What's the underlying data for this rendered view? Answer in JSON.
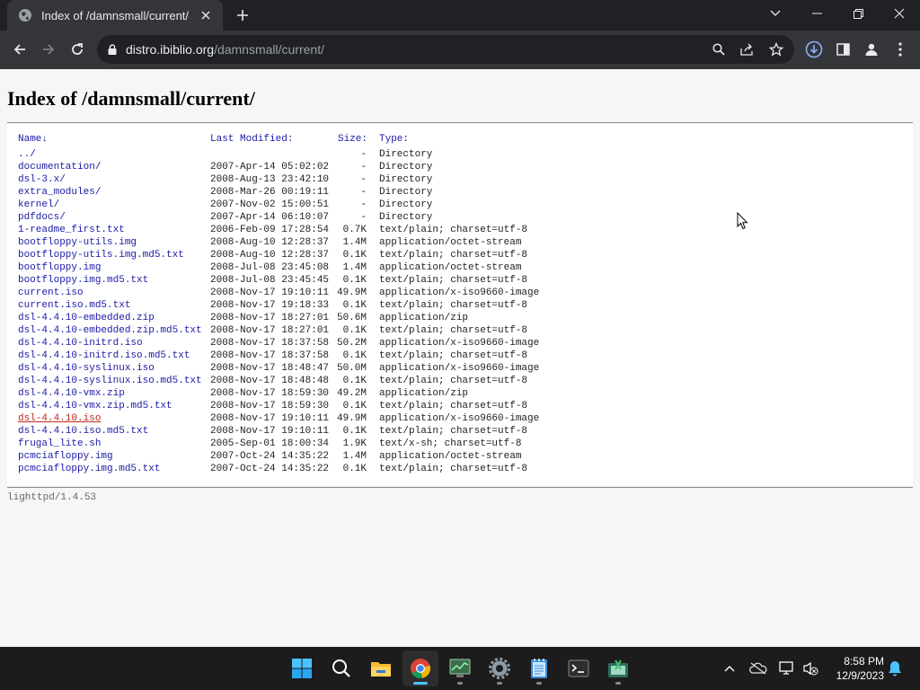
{
  "browser": {
    "tab_title": "Index of /damnsmall/current/",
    "url_host": "distro.ibiblio.org",
    "url_path": "/damnsmall/current/"
  },
  "page": {
    "heading": "Index of /damnsmall/current/",
    "columns": {
      "name": "Name↓",
      "modified": "Last Modified:",
      "size": "Size:",
      "type": "Type:"
    },
    "rows": [
      {
        "name": "../",
        "modified": "",
        "size": "-",
        "type": "Directory"
      },
      {
        "name": "documentation/",
        "modified": "2007-Apr-14 05:02:02",
        "size": "-",
        "type": "Directory"
      },
      {
        "name": "dsl-3.x/",
        "modified": "2008-Aug-13 23:42:10",
        "size": "-",
        "type": "Directory"
      },
      {
        "name": "extra_modules/",
        "modified": "2008-Mar-26 00:19:11",
        "size": "-",
        "type": "Directory"
      },
      {
        "name": "kernel/",
        "modified": "2007-Nov-02 15:00:51",
        "size": "-",
        "type": "Directory"
      },
      {
        "name": "pdfdocs/",
        "modified": "2007-Apr-14 06:10:07",
        "size": "-",
        "type": "Directory"
      },
      {
        "name": "1-readme_first.txt",
        "modified": "2006-Feb-09 17:28:54",
        "size": "0.7K",
        "type": "text/plain; charset=utf-8"
      },
      {
        "name": "bootfloppy-utils.img",
        "modified": "2008-Aug-10 12:28:37",
        "size": "1.4M",
        "type": "application/octet-stream"
      },
      {
        "name": "bootfloppy-utils.img.md5.txt",
        "modified": "2008-Aug-10 12:28:37",
        "size": "0.1K",
        "type": "text/plain; charset=utf-8"
      },
      {
        "name": "bootfloppy.img",
        "modified": "2008-Jul-08 23:45:08",
        "size": "1.4M",
        "type": "application/octet-stream"
      },
      {
        "name": "bootfloppy.img.md5.txt",
        "modified": "2008-Jul-08 23:45:45",
        "size": "0.1K",
        "type": "text/plain; charset=utf-8"
      },
      {
        "name": "current.iso",
        "modified": "2008-Nov-17 19:10:11",
        "size": "49.9M",
        "type": "application/x-iso9660-image"
      },
      {
        "name": "current.iso.md5.txt",
        "modified": "2008-Nov-17 19:18:33",
        "size": "0.1K",
        "type": "text/plain; charset=utf-8"
      },
      {
        "name": "dsl-4.4.10-embedded.zip",
        "modified": "2008-Nov-17 18:27:01",
        "size": "50.6M",
        "type": "application/zip"
      },
      {
        "name": "dsl-4.4.10-embedded.zip.md5.txt",
        "modified": "2008-Nov-17 18:27:01",
        "size": "0.1K",
        "type": "text/plain; charset=utf-8"
      },
      {
        "name": "dsl-4.4.10-initrd.iso",
        "modified": "2008-Nov-17 18:37:58",
        "size": "50.2M",
        "type": "application/x-iso9660-image"
      },
      {
        "name": "dsl-4.4.10-initrd.iso.md5.txt",
        "modified": "2008-Nov-17 18:37:58",
        "size": "0.1K",
        "type": "text/plain; charset=utf-8"
      },
      {
        "name": "dsl-4.4.10-syslinux.iso",
        "modified": "2008-Nov-17 18:48:47",
        "size": "50.0M",
        "type": "application/x-iso9660-image"
      },
      {
        "name": "dsl-4.4.10-syslinux.iso.md5.txt",
        "modified": "2008-Nov-17 18:48:48",
        "size": "0.1K",
        "type": "text/plain; charset=utf-8"
      },
      {
        "name": "dsl-4.4.10-vmx.zip",
        "modified": "2008-Nov-17 18:59:30",
        "size": "49.2M",
        "type": "application/zip"
      },
      {
        "name": "dsl-4.4.10-vmx.zip.md5.txt",
        "modified": "2008-Nov-17 18:59:30",
        "size": "0.1K",
        "type": "text/plain; charset=utf-8"
      },
      {
        "name": "dsl-4.4.10.iso",
        "modified": "2008-Nov-17 19:10:11",
        "size": "49.9M",
        "type": "application/x-iso9660-image",
        "visited": true
      },
      {
        "name": "dsl-4.4.10.iso.md5.txt",
        "modified": "2008-Nov-17 19:10:11",
        "size": "0.1K",
        "type": "text/plain; charset=utf-8"
      },
      {
        "name": "frugal_lite.sh",
        "modified": "2005-Sep-01 18:00:34",
        "size": "1.9K",
        "type": "text/x-sh; charset=utf-8"
      },
      {
        "name": "pcmciafloppy.img",
        "modified": "2007-Oct-24 14:35:22",
        "size": "1.4M",
        "type": "application/octet-stream"
      },
      {
        "name": "pcmciafloppy.img.md5.txt",
        "modified": "2007-Oct-24 14:35:22",
        "size": "0.1K",
        "type": "text/plain; charset=utf-8"
      }
    ],
    "footer": "lighttpd/1.4.53"
  },
  "taskbar": {
    "time": "8:58 PM",
    "date": "12/9/2023",
    "apps": [
      "start-icon",
      "search-icon",
      "file-explorer-icon",
      "chrome-icon",
      "task-manager-icon",
      "settings-icon",
      "notepad-icon",
      "terminal-icon",
      "snipping-tool-icon"
    ]
  },
  "colors": {
    "link": "#1a1aa6",
    "visited_link": "#c0281c",
    "accent": "#4cc2ff"
  }
}
